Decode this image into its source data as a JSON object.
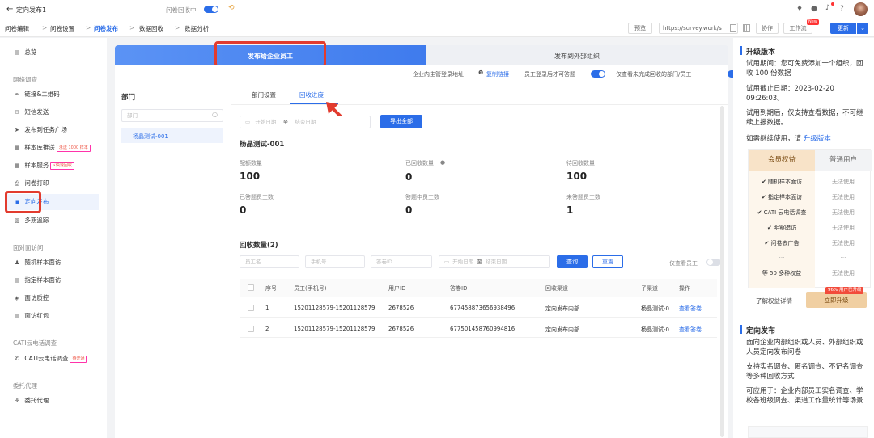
{
  "topbar": {
    "back_title": "定向发布1",
    "status_label": "问卷回收中",
    "history_icon": "⟲"
  },
  "nav": {
    "steps": [
      "问卷编辑",
      "问卷设置",
      "问卷发布",
      "数据回收",
      "数据分析"
    ],
    "active_step": "问卷发布",
    "preview": "预览",
    "url": "https://survey.work/s",
    "collab": "协作",
    "workflow": "工作流",
    "new_badge": "New",
    "update": "更新"
  },
  "sidebar": {
    "overview": "总览",
    "group_survey": "网络调查",
    "link_qr": "链接&二维码",
    "sms": "短信发送",
    "task_square": "发布到任务广场",
    "sample_push": "样本库推送",
    "sample_push_tag": "永送 1000 样本",
    "sample_service": "样本服务",
    "sample_service_tag": "⚡快速回收",
    "print": "问卷打印",
    "targeted": "定向发布",
    "multi_track": "多期追踪",
    "group_face": "面对面访问",
    "random_face": "随机样本面访",
    "assigned_face": "指定样本面访",
    "face_qc": "面访质控",
    "face_redpacket": "面访红包",
    "group_cati": "CATI云电话调查",
    "cati": "CATI云电话调查",
    "cati_tag": "待开通",
    "group_agent": "委托代理",
    "agent": "委托代理"
  },
  "main": {
    "tab_internal": "发布给企业员工",
    "tab_external": "发布到外部组织",
    "login_addr_label": "企业内主管登录地址",
    "copy_link": "复制链接",
    "login_answer_label": "员工登录后才可答题",
    "only_unfinished_label": "仅查看未完成回收的部门/员工",
    "dept_title": "部门",
    "dept_search_placeholder": "部门",
    "dept_item": "杨晶测试-001",
    "subtab_dept": "部门设置",
    "subtab_progress": "回收进度",
    "start_date": "开始日期",
    "to": "至",
    "end_date": "结束日期",
    "export_all": "导出全部",
    "section_title": "杨晶测试-001",
    "stats": [
      {
        "label": "配额数量",
        "value": "100"
      },
      {
        "label": "已回收数量",
        "value": "0"
      },
      {
        "label": "待回收数量",
        "value": "100"
      },
      {
        "label": "已答题员工数",
        "value": "0"
      },
      {
        "label": "答题中员工数",
        "value": "0"
      },
      {
        "label": "未答题员工数",
        "value": "1"
      }
    ],
    "recv_title": "回收数量(2)",
    "filter_employee": "员工名",
    "filter_phone": "手机号",
    "filter_answer_id": "答卷ID",
    "query": "查询",
    "reset": "重置",
    "only_employee": "仅查看员工",
    "columns": [
      "序号",
      "员工(手机号)",
      "用户ID",
      "答卷ID",
      "回收渠道",
      "子渠道",
      "操作"
    ],
    "rows": [
      {
        "no": "1",
        "employee": "15201128579-15201128579",
        "uid": "2678526",
        "aid": "677458873656938496",
        "channel": "定向发布内部",
        "sub": "杨晶测试-0",
        "op": "查看答卷"
      },
      {
        "no": "2",
        "employee": "15201128579-15201128579",
        "uid": "2678526",
        "aid": "677501458760994816",
        "channel": "定向发布内部",
        "sub": "杨晶测试-0",
        "op": "查看答卷"
      }
    ]
  },
  "right": {
    "upgrade_title": "升级版本",
    "trial_text": "试用期间：您可免费添加一个组织，回收 100 份数据",
    "deadline": "试用截止日期：2023-02-20 09:26:03。",
    "expire_text": "试用到期后，仅支持查看数据，不可继续上报数据。",
    "continue_text": "如需继续使用，请",
    "upgrade_link": "升级版本",
    "col_member": "会员权益",
    "col_normal": "普通用户",
    "benefits": [
      {
        "name": "✔ 随机样本面访",
        "normal": "无法使用"
      },
      {
        "name": "✔ 指定样本面访",
        "normal": "无法使用"
      },
      {
        "name": "✔ CATI 云电话调查",
        "normal": "无法使用"
      },
      {
        "name": "✔ 明察暗访",
        "normal": "无法使用"
      },
      {
        "name": "✔ 问卷去广告",
        "normal": "无法使用"
      }
    ],
    "ellipsis": "...",
    "more": "等 50 多种权益",
    "more_normal": "无法使用",
    "details": "了解权益详情",
    "upgrade_badge": "96% 用户已升级",
    "upgrade_now": "立即升级",
    "targeted_title": "定向发布",
    "targeted_p1": "面向企业内部组织或人员、外部组织或人员定向发布问卷",
    "targeted_p2": "支持实名调查、匿名调查、不记名调查等多种回收方式",
    "targeted_p3": "可应用于：企业内部员工实名调查、学校各班级调查、渠道工作量统计等场景"
  },
  "colors": {
    "accent": "#2b6de8",
    "highlight": "#e23b2e",
    "gold": "#c79a5b"
  }
}
